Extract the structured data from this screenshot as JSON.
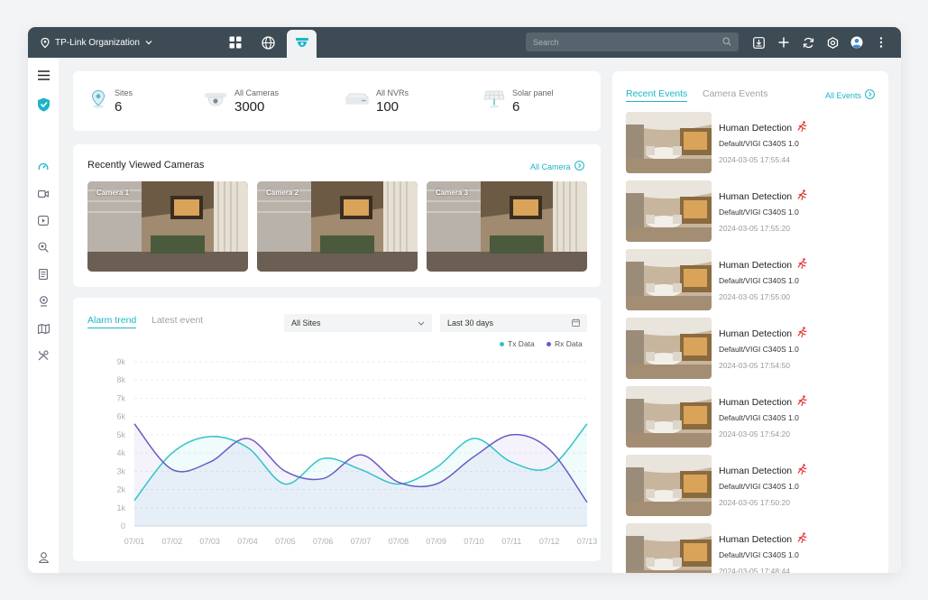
{
  "topbar": {
    "org_name": "TP-Link Organization",
    "search_placeholder": "Search"
  },
  "stats": [
    {
      "label": "Sites",
      "value": "6"
    },
    {
      "label": "All Cameras",
      "value": "3000"
    },
    {
      "label": "All NVRs",
      "value": "100"
    },
    {
      "label": "Solar panel",
      "value": "6"
    }
  ],
  "recent_cameras": {
    "title": "Recently Viewed Cameras",
    "link": "All Camera",
    "cameras": [
      "Camera 1",
      "Camera 2",
      "Camera 3"
    ]
  },
  "alarm": {
    "tabs": [
      "Alarm trend",
      "Latest event"
    ],
    "site_select": "All Sites",
    "range_select": "Last 30 days"
  },
  "events": {
    "tabs": [
      "Recent Events",
      "Camera Events"
    ],
    "link": "All Events",
    "items": [
      {
        "title": "Human Detection",
        "device": "Default/VIGI C340S 1.0",
        "time": "2024-03-05 17:55:44"
      },
      {
        "title": "Human Detection",
        "device": "Default/VIGI C340S 1.0",
        "time": "2024-03-05 17:55:20"
      },
      {
        "title": "Human Detection",
        "device": "Default/VIGI C340S 1.0",
        "time": "2024-03-05 17:55:00"
      },
      {
        "title": "Human Detection",
        "device": "Default/VIGI C340S 1.0",
        "time": "2024-03-05 17:54:50"
      },
      {
        "title": "Human Detection",
        "device": "Default/VIGI C340S 1.0",
        "time": "2024-03-05 17:54:20"
      },
      {
        "title": "Human Detection",
        "device": "Default/VIGI C340S 1.0",
        "time": "2024-03-05 17:50:20"
      },
      {
        "title": "Human Detection",
        "device": "Default/VIGI C340S 1.0",
        "time": "2024-03-05 17:48:44"
      }
    ]
  },
  "colors": {
    "accent": "#1bb5c9",
    "tx": "#2ec4c8",
    "rx": "#6a5bc4",
    "topbar": "#3d4b54",
    "alert": "#e53935"
  },
  "chart_data": {
    "type": "line",
    "x": [
      "07/01",
      "07/02",
      "07/03",
      "07/04",
      "07/05",
      "07/06",
      "07/07",
      "07/08",
      "07/09",
      "07/10",
      "07/11",
      "07/12",
      "07/13"
    ],
    "y_ticks": [
      "0",
      "1k",
      "2k",
      "3k",
      "4k",
      "5k",
      "6k",
      "7k",
      "8k",
      "9k"
    ],
    "ylim": [
      0,
      9000
    ],
    "series": [
      {
        "name": "Tx Data",
        "values": [
          1400,
          4000,
          4900,
          4300,
          2300,
          3700,
          3100,
          2300,
          3200,
          4800,
          3500,
          3200,
          5600
        ]
      },
      {
        "name": "Rx Data",
        "values": [
          5600,
          3100,
          3500,
          4800,
          3000,
          2600,
          3900,
          2400,
          2300,
          3800,
          5000,
          4200,
          1300
        ]
      }
    ],
    "legend": "top-right",
    "grid": true
  }
}
